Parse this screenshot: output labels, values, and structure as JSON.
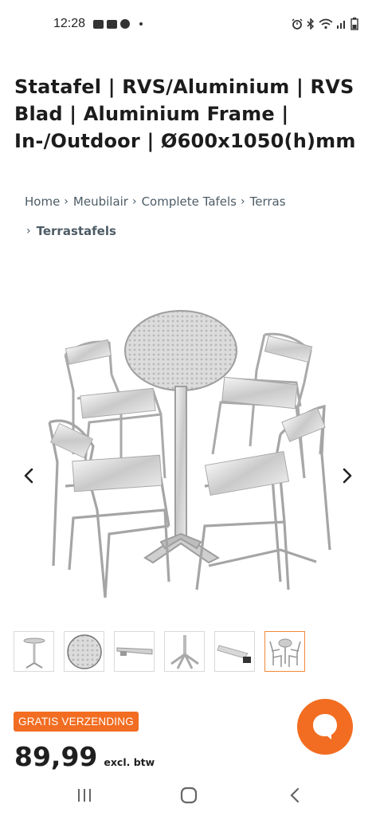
{
  "status_bar": {
    "time": "12:28",
    "left_icons": [
      "image-icon",
      "youtube-icon",
      "messenger-icon",
      "dot-icon"
    ],
    "right_icons": [
      "alarm-icon",
      "bluetooth-icon",
      "wifi-icon",
      "signal-icon",
      "battery-icon"
    ]
  },
  "product": {
    "title": "Statafel | RVS/Aluminium | RVS Blad | Aluminium Frame | In-/Outdoor | Ø600x1050(h)mm"
  },
  "breadcrumb": {
    "items": [
      "Home",
      "Meubilair",
      "Complete Tafels",
      "Terras"
    ],
    "current": "Terrastafels",
    "separator": "›"
  },
  "gallery": {
    "prev_icon": "chevron-left-icon",
    "next_icon": "chevron-right-icon",
    "thumbnails": [
      {
        "name": "thumb-table-full",
        "active": false
      },
      {
        "name": "thumb-table-top",
        "active": false
      },
      {
        "name": "thumb-table-edge",
        "active": false
      },
      {
        "name": "thumb-table-base",
        "active": false
      },
      {
        "name": "thumb-table-foot",
        "active": false
      },
      {
        "name": "thumb-table-set",
        "active": true
      }
    ]
  },
  "shipping_badge": "GRATIS VERZENDING",
  "price": {
    "value": "89,99",
    "note": "excl. btw"
  },
  "colors": {
    "accent": "#f26d21",
    "text": "#1f1f1f",
    "breadcrumb": "#4d5c66",
    "thumb_active_border": "#f08a3a"
  },
  "nav_bar": [
    "recents-icon",
    "home-icon",
    "back-icon"
  ]
}
